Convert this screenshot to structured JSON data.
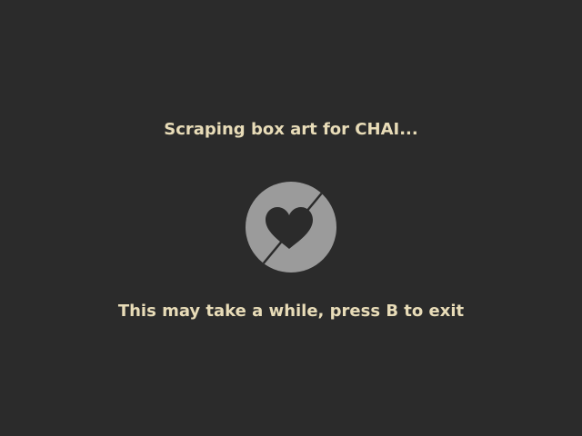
{
  "screen": {
    "title": "Scraping box art for CHAI...",
    "hint": "This may take a while, press B to exit",
    "icon": "loading-heart-logo-icon"
  },
  "colors": {
    "background": "#2b2b2b",
    "text": "#e8dcb8",
    "logo_circle": "#9b9b9b",
    "logo_heart": "#2b2b2b"
  }
}
